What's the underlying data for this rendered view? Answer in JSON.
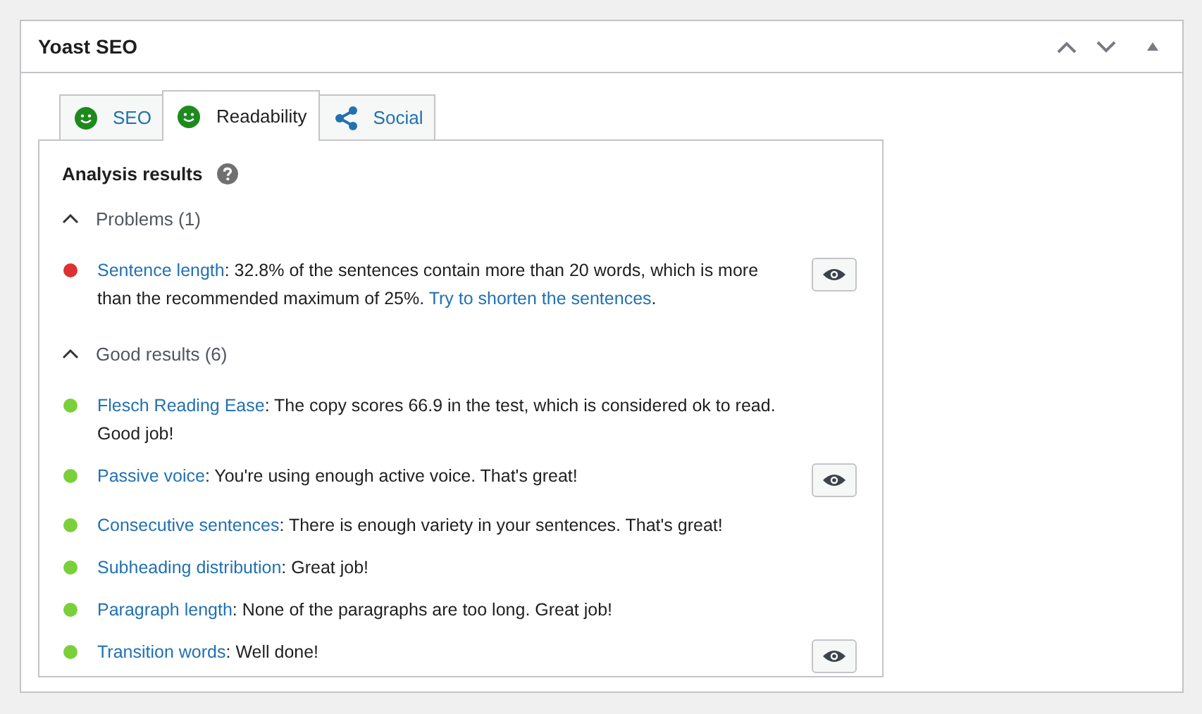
{
  "panel": {
    "title": "Yoast SEO"
  },
  "tabs": [
    {
      "label": "SEO",
      "kind": "smiley",
      "color": "#1e8a1e",
      "selected": false
    },
    {
      "label": "Readability",
      "kind": "smiley",
      "color": "#1e8a1e",
      "selected": true
    },
    {
      "label": "Social",
      "kind": "share",
      "selected": false
    }
  ],
  "analysis": {
    "heading": "Analysis results",
    "groups": [
      {
        "title": "Problems (1)",
        "expanded": true,
        "results": [
          {
            "link": "Sentence length",
            "text": ": 32.8% of the sentences contain more than 20 words, which is more than the recommended maximum of 25%. ",
            "link_2": "Try to shorten the sentences",
            "text_2": ".",
            "color": "#dc3232",
            "eye_button": true
          }
        ]
      },
      {
        "title": "Good results (6)",
        "expanded": true,
        "results": [
          {
            "link": "Flesch Reading Ease",
            "text": ": The copy scores 66.9 in the test, which is considered ok to read. Good job!",
            "color": "#7ad03a",
            "eye_button": false
          },
          {
            "link": "Passive voice",
            "text": ": You're using enough active voice. That's great!",
            "color": "#7ad03a",
            "eye_button": true
          },
          {
            "link": "Consecutive sentences",
            "text": ": There is enough variety in your sentences. That's great!",
            "color": "#7ad03a",
            "eye_button": false
          },
          {
            "link": "Subheading distribution",
            "text": ": Great job!",
            "color": "#7ad03a",
            "eye_button": false
          },
          {
            "link": "Paragraph length",
            "text": ": None of the paragraphs are too long. Great job!",
            "color": "#7ad03a",
            "eye_button": false
          },
          {
            "link": "Transition words",
            "text": ": Well done!",
            "color": "#7ad03a",
            "eye_button": true
          }
        ]
      }
    ]
  }
}
